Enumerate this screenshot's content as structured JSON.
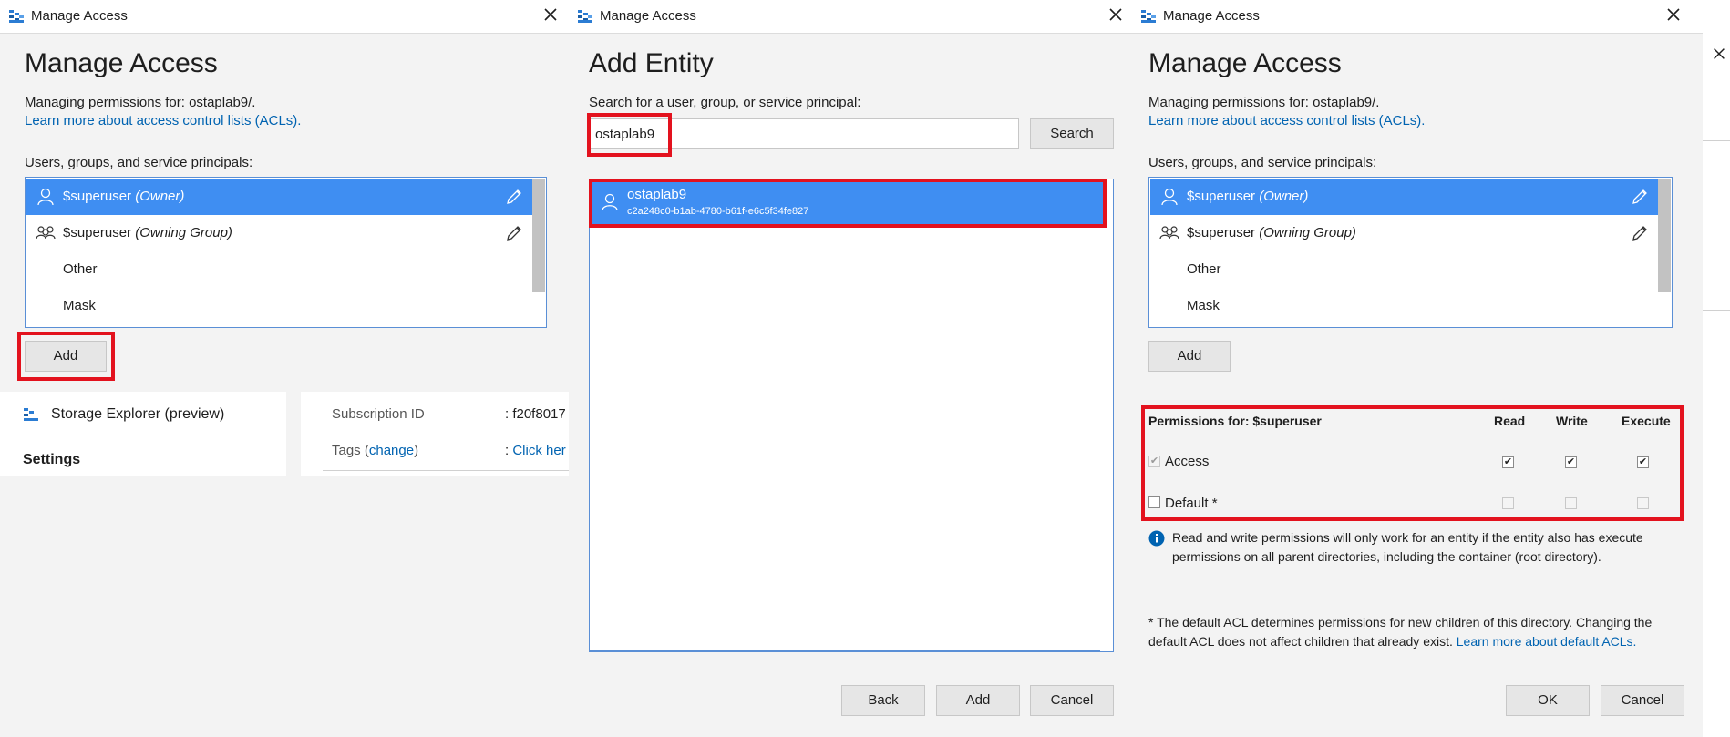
{
  "colors": {
    "accent": "#3f8ef2",
    "link": "#0063b1",
    "highlight": "#e3121e"
  },
  "window1": {
    "titlebar": {
      "title": "Manage Access"
    },
    "heading": "Manage Access",
    "managing_label": "Managing permissions for: ostaplab9/.",
    "learn_link": "Learn more about access control lists (ACLs).",
    "principals_label": "Users, groups, and service principals:",
    "list": [
      {
        "name": "$superuser",
        "role": "(Owner)",
        "icon": "user-icon"
      },
      {
        "name": "$superuser",
        "role": "(Owning Group)",
        "icon": "group-icon"
      },
      {
        "name": "Other",
        "role": ""
      },
      {
        "name": "Mask",
        "role": ""
      }
    ],
    "add_button": "Add"
  },
  "background": {
    "storage_explorer": "Storage Explorer (preview)",
    "settings": "Settings",
    "subscription_label": "Subscription ID",
    "subscription_value": ": f20f8017",
    "tags_label": "Tags (",
    "tags_change": "change",
    "tags_close": ")",
    "tags_value_prefix": ":",
    "tags_value_link": "Click her"
  },
  "window2": {
    "titlebar": {
      "title": "Manage Access"
    },
    "heading": "Add Entity",
    "search_label": "Search for a user, group, or service principal:",
    "search_value": "ostaplab9",
    "search_button": "Search",
    "result": {
      "name": "ostaplab9",
      "id": "c2a248c0-b1ab-4780-b61f-e6c5f34fe827"
    },
    "back_button": "Back",
    "add_button": "Add",
    "cancel_button": "Cancel"
  },
  "window3": {
    "titlebar": {
      "title": "Manage Access"
    },
    "heading": "Manage Access",
    "managing_label": "Managing permissions for: ostaplab9/.",
    "learn_link": "Learn more about access control lists (ACLs).",
    "principals_label": "Users, groups, and service principals:",
    "list": [
      {
        "name": "$superuser",
        "role": "(Owner)",
        "icon": "user-icon"
      },
      {
        "name": "$superuser",
        "role": "(Owning Group)",
        "icon": "group-icon"
      },
      {
        "name": "Other",
        "role": ""
      },
      {
        "name": "Mask",
        "role": ""
      }
    ],
    "add_button": "Add",
    "permissions": {
      "header": "Permissions for: $superuser",
      "columns": [
        "Read",
        "Write",
        "Execute"
      ],
      "rows": [
        {
          "label": "Access",
          "enabled": true,
          "checked": true,
          "read": true,
          "write": true,
          "execute": true
        },
        {
          "label": "Default *",
          "enabled": false,
          "checked": false,
          "read": false,
          "write": false,
          "execute": false
        }
      ]
    },
    "info_text": "Read and write permissions will only work for an entity if the entity also has execute permissions on all parent directories, including the container (root directory).",
    "default_note": "* The default ACL determines permissions for new children of this directory. Changing the default ACL does not affect children that already exist.",
    "default_note_link": "Learn more about default ACLs.",
    "ok_button": "OK",
    "cancel_button": "Cancel"
  }
}
